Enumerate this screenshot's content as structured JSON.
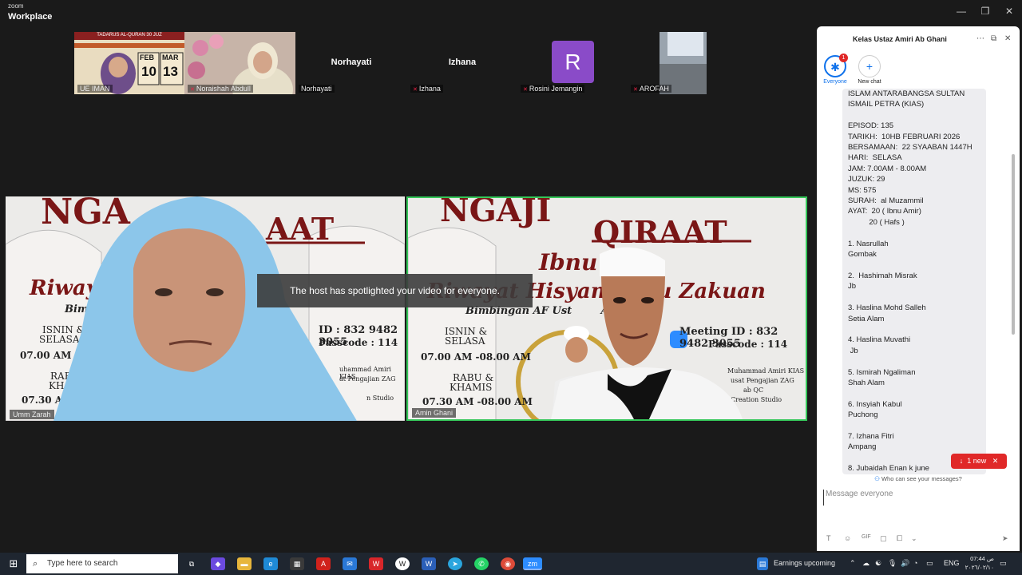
{
  "app": {
    "brand_top": "zoom",
    "brand_bottom": "Workplace"
  },
  "window_controls": [
    "minimize-icon",
    "restore-icon",
    "close-icon"
  ],
  "gallery": [
    {
      "name": "UE IMAN",
      "mic_muted": false,
      "poster": "TADARUS AL-QURAN 30 JUZ",
      "dates": [
        "FEB",
        "MAR",
        "10",
        "13"
      ]
    },
    {
      "name": "Noraishah Abdull",
      "mic_muted": true
    },
    {
      "name": "Norhayati",
      "display": "Norhayati",
      "mic_muted": false
    },
    {
      "name": "Izhana",
      "display": "Izhana",
      "mic_muted": true
    },
    {
      "name": "Rosini Jemangin",
      "avatar": "R",
      "mic_muted": true
    },
    {
      "name": "AROFAH",
      "mic_muted": true
    }
  ],
  "speakers": [
    {
      "name": "Umm Zarah",
      "poster_title": "NGA",
      "poster_title2": "AAT",
      "poster_line": "Riwayat",
      "poster_sub": "Bimb",
      "days1": "ISNIN &",
      "days2": "SELASA",
      "time1": "07.00 AM -08.0",
      "days3": "RAB",
      "days4": "KH",
      "time2": "07.30 AM",
      "meet": "ID : 832 9482 3055",
      "pass": "Passcode : 114",
      "org1": "uhammad Amiri KIAS",
      "org2": "at Pengajian ZAG",
      "org3": "n Studio"
    },
    {
      "name": "Amin Ghani",
      "poster_title": "NGAJI",
      "poster_title2": "QIRAAT",
      "poster_line": "Ibnu",
      "poster_line2": "Riwayat Hisyam  bnu Zakuan",
      "poster_sub": "Bimbingan AF Ust        Ab. Ghani",
      "days1": "ISNIN &",
      "days2": "SELASA",
      "time1": "07.00 AM -08.00 AM",
      "days3": "RABU &",
      "days4": "KHAMIS",
      "time2": "07.30 AM -08.00 AM",
      "meet": "Meeting ID : 832 9482 3055",
      "pass": "Passcode : 114",
      "org1": "Muhammad Amiri KIAS",
      "org2": "usat Pengajian ZAG",
      "org3": "ab QC",
      "org4": "Creation Studio"
    }
  ],
  "toast": "The host has spotlighted your video for everyone.",
  "chat": {
    "title": "Kelas Ustaz Amiri Ab Ghani",
    "channels": [
      {
        "label": "Everyone",
        "badge": "1"
      },
      {
        "label": "New chat"
      }
    ],
    "message_lines": [
      "ISLAM ANTARABANGSA SULTAN",
      "ISMAIL PETRA (KIAS)",
      "",
      "EPISOD: 135",
      "TARIKH:  10HB FEBRUARI 2026",
      "BERSAMAAN:  22 SYAABAN 1447H",
      "HARI:  SELASA",
      "JAM: 7.00AM - 8.00AM",
      "JUZUK: 29",
      "MS: 575",
      "SURAH:  al Muzammil",
      "AYAT:  20 ( Ibnu Amir)",
      "          20 ( Hafs )",
      "",
      "1. Nasrullah",
      "Gombak",
      "",
      "2.  Hashimah Misrak",
      "Jb",
      "",
      "3. Haslina Mohd Salleh",
      "Setia Alam",
      "",
      "4. Haslina Muvathi",
      " Jb",
      "",
      "5. Ismirah Ngaliman",
      "Shah Alam",
      "",
      "6. Insyiah Kabul",
      "Puchong",
      "",
      "7. Izhana Fitri",
      "Ampang",
      "",
      "8. Jubaidah Enan k june"
    ],
    "new_pill": "1 new",
    "who_can_see": "Who can see your messages?",
    "input_placeholder": "Message everyone",
    "tool_gif": "GIF"
  },
  "taskbar": {
    "search_placeholder": "Type here to search",
    "weather": "Earnings upcoming",
    "lang": "ENG",
    "time": "07:44 ص",
    "date": "٢٠٢٦/٠٢/١٠"
  },
  "colors": {
    "accent": "#0e71eb",
    "speaker_border": "#35c759",
    "alert": "#e02828",
    "avatar": "#8a4bc8"
  }
}
